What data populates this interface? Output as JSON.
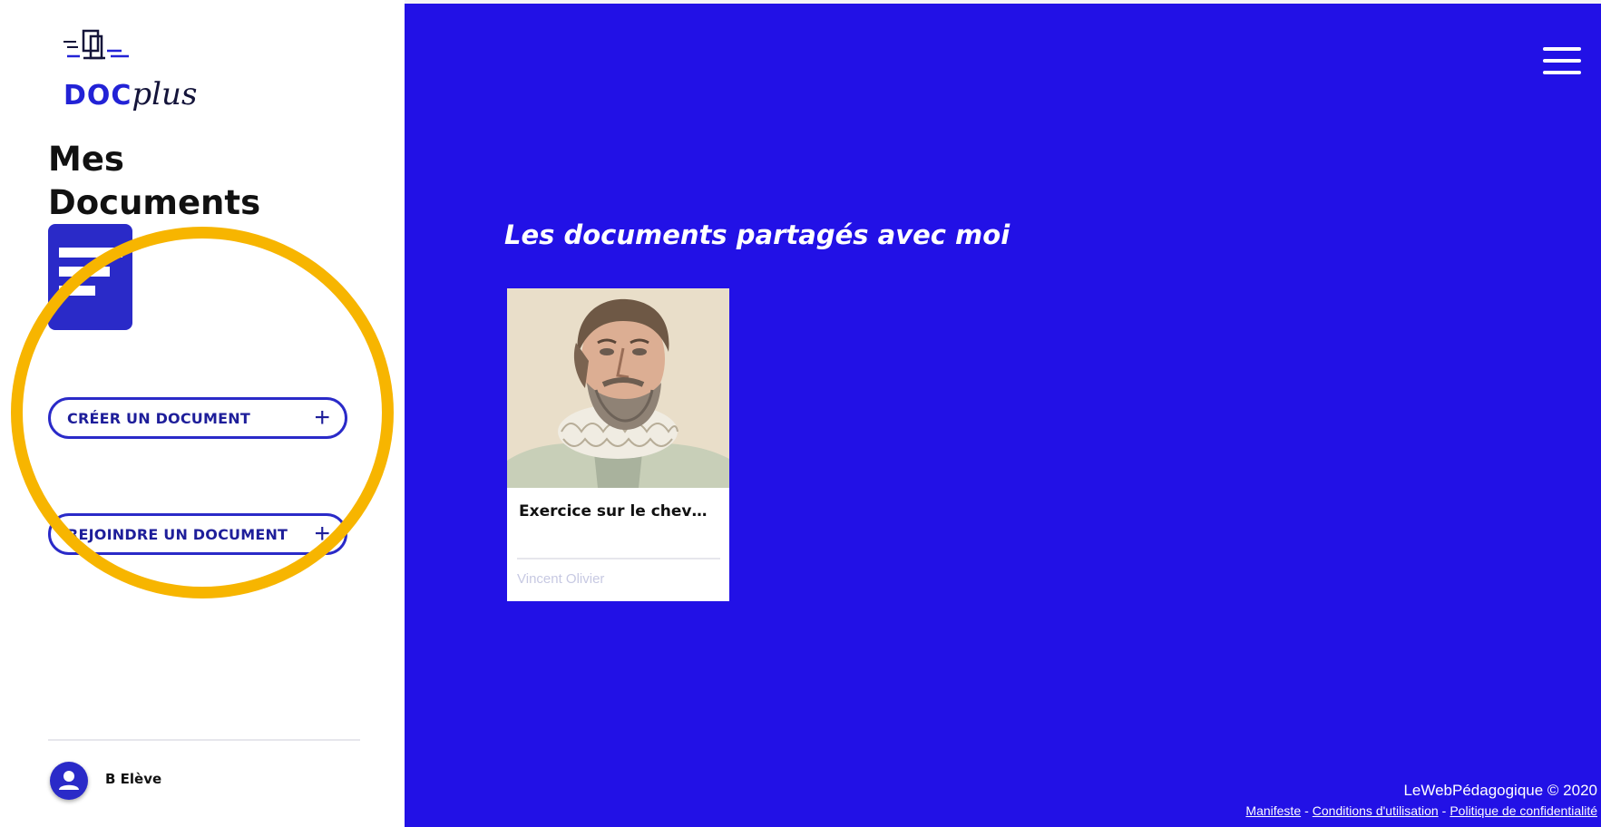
{
  "brand": {
    "logo_primary": "DOC",
    "logo_secondary": "plus",
    "primary_color": "#2222d6",
    "secondary_color": "#14143a"
  },
  "sidebar": {
    "title_line1": "Mes",
    "title_line2": "Documents",
    "create_button_label": "CRÉER UN DOCUMENT",
    "join_button_label": "REJOINDRE UN DOCUMENT",
    "create_button_icon": "plus-icon",
    "join_button_icon": "plus-icon",
    "user": {
      "name": "B Elève",
      "avatar_icon": "user-icon"
    }
  },
  "main": {
    "background_color": "#2211e6",
    "menu_icon": "hamburger-menu-icon",
    "section_title": "Les documents partagés avec moi",
    "documents": [
      {
        "title": "Exercice sur le chev…",
        "author": "Vincent Olivier",
        "thumbnail": "portrait-image"
      }
    ]
  },
  "footer": {
    "copyright": "LeWebPédagogique © 2020",
    "links": [
      "Manifeste",
      "Conditions d'utilisation",
      "Politique de confidentialité"
    ]
  },
  "annotation": {
    "highlight_color": "#f7b500",
    "shape": "circle"
  }
}
